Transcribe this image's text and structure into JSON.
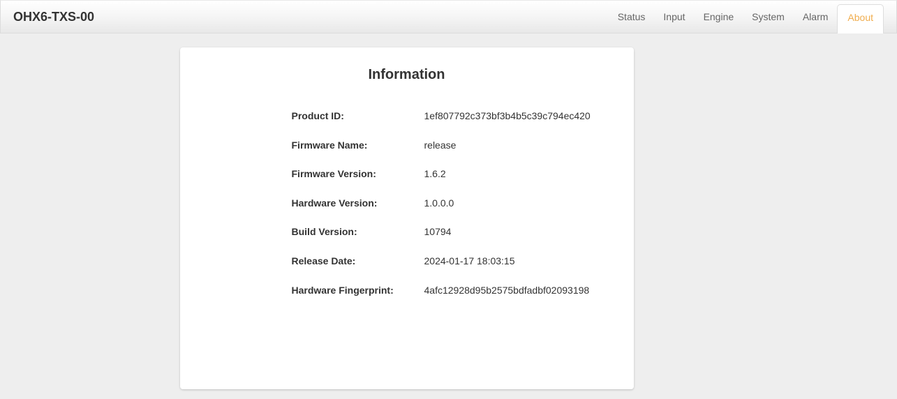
{
  "header": {
    "logo": "OHX6-TXS-00",
    "tabs": {
      "status": "Status",
      "input": "Input",
      "engine": "Engine",
      "system": "System",
      "alarm": "Alarm",
      "about": "About"
    }
  },
  "card": {
    "title": "Information",
    "rows": {
      "product_id": {
        "label": "Product ID:",
        "value": "1ef807792c373bf3b4b5c39c794ec420"
      },
      "firmware_name": {
        "label": "Firmware Name:",
        "value": "release"
      },
      "firmware_version": {
        "label": "Firmware Version:",
        "value": "1.6.2"
      },
      "hardware_version": {
        "label": "Hardware Version:",
        "value": "1.0.0.0"
      },
      "build_version": {
        "label": "Build Version:",
        "value": "10794"
      },
      "release_date": {
        "label": "Release Date:",
        "value": "2024-01-17 18:03:15"
      },
      "hardware_fingerprint": {
        "label": "Hardware Fingerprint:",
        "value": "4afc12928d95b2575bdfadbf02093198"
      }
    }
  }
}
